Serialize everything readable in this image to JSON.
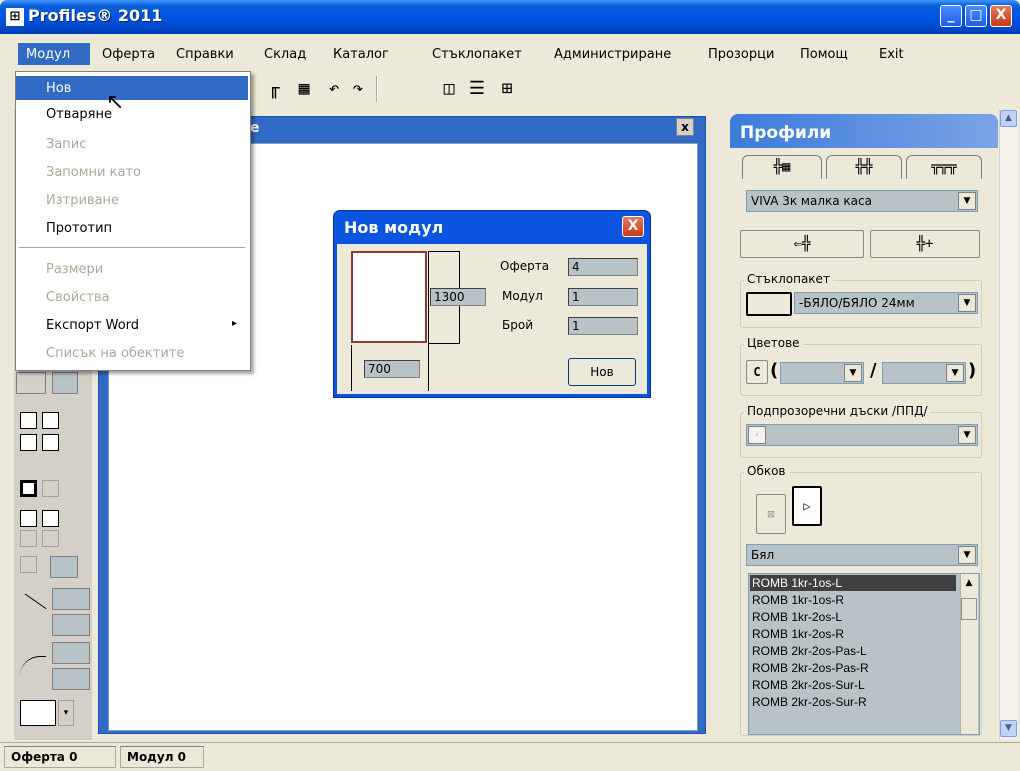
{
  "window": {
    "title": "Profiles® 2011",
    "app_icon": "profiles-app-icon",
    "min_glyph": "_",
    "max_glyph": "□",
    "close_glyph": "X"
  },
  "menubar": {
    "items": [
      "Модул",
      "Оферта",
      "Справки",
      "Склад",
      "Каталог",
      "Стъклопакет",
      "Администриране",
      "Прозорци",
      "Помощ",
      "Exit"
    ]
  },
  "toolbar": {
    "icons": [
      "frame-profile-icon",
      "grid-frame-icon",
      "undo-icon",
      "redo-icon",
      "double-sash-icon",
      "lines-icon",
      "table-icon"
    ]
  },
  "dropdown": {
    "items": [
      {
        "label": "Нов",
        "enabled": true,
        "highlighted": true
      },
      {
        "label": "Отваряне",
        "enabled": true
      },
      {
        "label": "Запис",
        "enabled": false
      },
      {
        "label": "Запомни като",
        "enabled": false
      },
      {
        "label": "Изтриване",
        "enabled": false
      },
      {
        "label": "Прототип",
        "enabled": true
      },
      {
        "label": "Размери",
        "enabled": false
      },
      {
        "label": "Свойства",
        "enabled": false
      },
      {
        "label": "Експорт Word",
        "enabled": true,
        "submenu": true
      },
      {
        "label": "Списък на обектите",
        "enabled": false
      }
    ],
    "submenu_arrow": "▸"
  },
  "child_window": {
    "title_fragment": "е",
    "close_glyph": "x"
  },
  "dialog": {
    "title": "Нов модул",
    "height_value": "1300",
    "width_value": "700",
    "fields": [
      {
        "label": "Оферта",
        "value": "4"
      },
      {
        "label": "Модул",
        "value": "1"
      },
      {
        "label": "Брой",
        "value": "1"
      }
    ],
    "new_button": "Нов"
  },
  "profiles_panel": {
    "title": "Профили",
    "profile_system": "VIVA 3к малка каса",
    "glass_group": "Стъклопакет",
    "glass_value": "-БЯЛО/БЯЛО 24мм",
    "colors_group": "Цветове",
    "colors_prefix": "C",
    "sills_group": "Подпрозоречни дъски /ППД/",
    "hardware_group": "Обков",
    "hardware_color": "Бял",
    "hardware_items": [
      "ROMB 1kr-1os-L",
      "ROMB 1kr-1os-R",
      "ROMB 1kr-2os-L",
      "ROMB 1kr-2os-R",
      "ROMB 2kr-2os-Pas-L",
      "ROMB 2kr-2os-Pas-R",
      "ROMB 2kr-2os-Sur-L",
      "ROMB 2kr-2os-Sur-R"
    ]
  },
  "statusbar": {
    "offer_label": "Оферта  0",
    "module_label": "Модул  0"
  }
}
